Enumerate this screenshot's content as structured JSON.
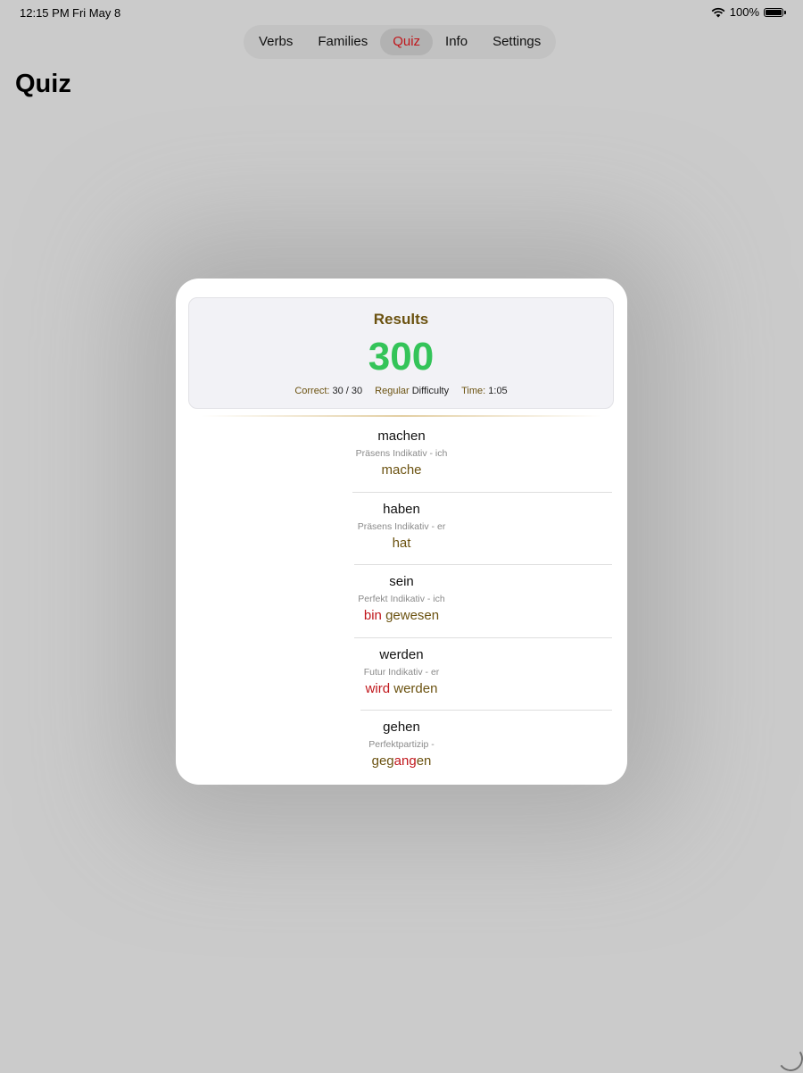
{
  "status_bar": {
    "time": "12:15 PM",
    "date": "Fri May 8",
    "battery": "100%"
  },
  "tabs": [
    {
      "label": "Verbs",
      "active": false
    },
    {
      "label": "Families",
      "active": false
    },
    {
      "label": "Quiz",
      "active": true
    },
    {
      "label": "Info",
      "active": false
    },
    {
      "label": "Settings",
      "active": false
    }
  ],
  "page_title": "Quiz",
  "results": {
    "title": "Results",
    "score": "300",
    "correct_label": "Correct:",
    "correct_value": "30 / 30",
    "difficulty_label": "Regular",
    "difficulty_value": "Difficulty",
    "time_label": "Time:",
    "time_value": "1:05"
  },
  "items": [
    {
      "verb": "machen",
      "form": "Präsens Indikativ - ich",
      "answer": [
        {
          "text": "mache",
          "wrong": false
        }
      ]
    },
    {
      "verb": "haben",
      "form": "Präsens Indikativ - er",
      "answer": [
        {
          "text": "hat",
          "wrong": false
        }
      ]
    },
    {
      "verb": "sein",
      "form": "Perfekt Indikativ - ich",
      "answer": [
        {
          "text": "bin",
          "wrong": true
        },
        {
          "text": " gewesen",
          "wrong": false
        }
      ]
    },
    {
      "verb": "werden",
      "form": "Futur Indikativ - er",
      "answer": [
        {
          "text": "wird",
          "wrong": true
        },
        {
          "text": " werden",
          "wrong": false
        }
      ]
    },
    {
      "verb": "gehen",
      "form": "Perfektpartizip -",
      "answer": [
        {
          "text": "geg",
          "wrong": false
        },
        {
          "text": "ang",
          "wrong": true
        },
        {
          "text": "en",
          "wrong": false
        }
      ]
    }
  ],
  "colors": {
    "accent_red": "#c0161b",
    "score_green": "#34c459",
    "brown": "#6b5210"
  }
}
